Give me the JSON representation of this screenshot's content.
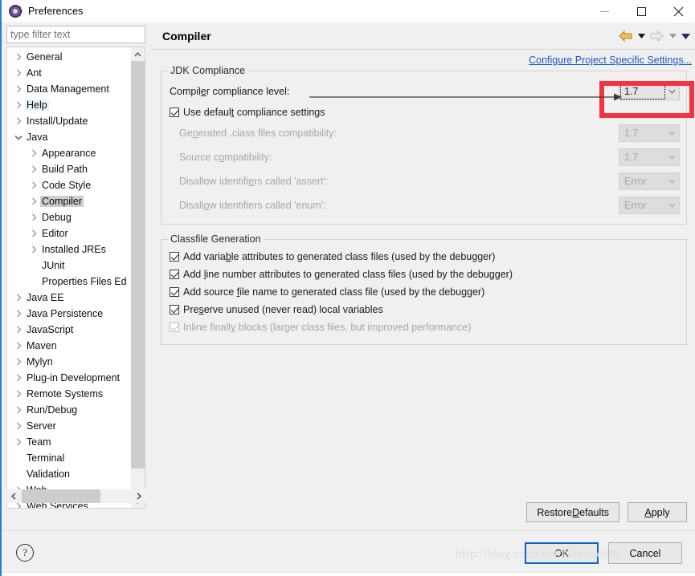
{
  "window": {
    "title": "Preferences",
    "icon": "preferences-gear-icon",
    "controls": {
      "minimize": "minimize-icon",
      "maximize": "maximize-icon",
      "close": "close-icon"
    }
  },
  "filter": {
    "placeholder": "type filter text",
    "value": ""
  },
  "tree": {
    "items": [
      {
        "label": "General",
        "level": 1,
        "twisty": "collapsed",
        "state": "normal"
      },
      {
        "label": "Ant",
        "level": 1,
        "twisty": "collapsed",
        "state": "normal"
      },
      {
        "label": "Data Management",
        "level": 1,
        "twisty": "collapsed",
        "state": "normal"
      },
      {
        "label": "Help",
        "level": 1,
        "twisty": "collapsed",
        "state": "hover"
      },
      {
        "label": "Install/Update",
        "level": 1,
        "twisty": "collapsed",
        "state": "normal"
      },
      {
        "label": "Java",
        "level": 1,
        "twisty": "expanded",
        "state": "normal"
      },
      {
        "label": "Appearance",
        "level": 2,
        "twisty": "collapsed",
        "state": "normal"
      },
      {
        "label": "Build Path",
        "level": 2,
        "twisty": "collapsed",
        "state": "normal"
      },
      {
        "label": "Code Style",
        "level": 2,
        "twisty": "collapsed",
        "state": "normal"
      },
      {
        "label": "Compiler",
        "level": 2,
        "twisty": "collapsed",
        "state": "selected"
      },
      {
        "label": "Debug",
        "level": 2,
        "twisty": "collapsed",
        "state": "normal"
      },
      {
        "label": "Editor",
        "level": 2,
        "twisty": "collapsed",
        "state": "normal"
      },
      {
        "label": "Installed JREs",
        "level": 2,
        "twisty": "collapsed",
        "state": "normal"
      },
      {
        "label": "JUnit",
        "level": 2,
        "twisty": "none",
        "state": "normal"
      },
      {
        "label": "Properties Files Ed",
        "level": 2,
        "twisty": "none",
        "state": "normal"
      },
      {
        "label": "Java EE",
        "level": 1,
        "twisty": "collapsed",
        "state": "normal"
      },
      {
        "label": "Java Persistence",
        "level": 1,
        "twisty": "collapsed",
        "state": "normal"
      },
      {
        "label": "JavaScript",
        "level": 1,
        "twisty": "collapsed",
        "state": "normal"
      },
      {
        "label": "Maven",
        "level": 1,
        "twisty": "collapsed",
        "state": "normal"
      },
      {
        "label": "Mylyn",
        "level": 1,
        "twisty": "collapsed",
        "state": "normal"
      },
      {
        "label": "Plug-in Development",
        "level": 1,
        "twisty": "collapsed",
        "state": "normal"
      },
      {
        "label": "Remote Systems",
        "level": 1,
        "twisty": "collapsed",
        "state": "normal"
      },
      {
        "label": "Run/Debug",
        "level": 1,
        "twisty": "collapsed",
        "state": "normal"
      },
      {
        "label": "Server",
        "level": 1,
        "twisty": "collapsed",
        "state": "normal"
      },
      {
        "label": "Team",
        "level": 1,
        "twisty": "collapsed",
        "state": "normal"
      },
      {
        "label": "Terminal",
        "level": 1,
        "twisty": "none",
        "state": "normal"
      },
      {
        "label": "Validation",
        "level": 1,
        "twisty": "none",
        "state": "normal"
      },
      {
        "label": "Web",
        "level": 1,
        "twisty": "collapsed",
        "state": "normal"
      },
      {
        "label": "Web Services",
        "level": 1,
        "twisty": "collapsed",
        "state": "normal"
      }
    ]
  },
  "page": {
    "title": "Compiler",
    "configure_link": "Configure Project Specific Settings...",
    "nav": {
      "back_icon": "back-arrow-icon",
      "back_menu_icon": "back-dropdown-icon",
      "forward_icon": "forward-arrow-icon",
      "forward_menu_icon": "forward-dropdown-icon",
      "view_menu_icon": "view-menu-icon"
    }
  },
  "jdk_compliance": {
    "group_title": "JDK Compliance",
    "compliance_level": {
      "label": "Compiler compliance level:",
      "value": "1.7",
      "enabled": true,
      "focused": true
    },
    "use_default": {
      "label": "Use default compliance settings",
      "checked": true,
      "enabled": true
    },
    "disabled_rows": [
      {
        "label": "Generated .class files compatibility:",
        "value": "1.7",
        "mnemonic_index": 2
      },
      {
        "label": "Source compatibility:",
        "value": "1.7",
        "mnemonic_index": 8
      },
      {
        "label": "Disallow identifiers called 'assert':",
        "value": "Error",
        "mnemonic_index": 17
      },
      {
        "label": "Disallow identifiers called 'enum':",
        "value": "Error",
        "mnemonic_index": 6
      }
    ]
  },
  "classfile_generation": {
    "group_title": "Classfile Generation",
    "options": [
      {
        "label": "Add variable attributes to generated class files (used by the debugger)",
        "checked": true,
        "enabled": true
      },
      {
        "label": "Add line number attributes to generated class files (used by the debugger)",
        "checked": true,
        "enabled": true
      },
      {
        "label": "Add source file name to generated class file (used by the debugger)",
        "checked": true,
        "enabled": true
      },
      {
        "label": "Preserve unused (never read) local variables",
        "checked": true,
        "enabled": true
      },
      {
        "label": "Inline finally blocks (larger class files, but improved performance)",
        "checked": true,
        "enabled": false
      }
    ]
  },
  "page_buttons": {
    "restore_defaults": "Restore Defaults",
    "apply": "Apply"
  },
  "footer": {
    "help_icon": "help-question-icon",
    "ok": "OK",
    "cancel": "Cancel"
  },
  "annotation": {
    "highlight_color": "#f5333f",
    "arrow_color": "#3c3c3c"
  },
  "watermark": "http://blog.csdn.net/Newbie006"
}
